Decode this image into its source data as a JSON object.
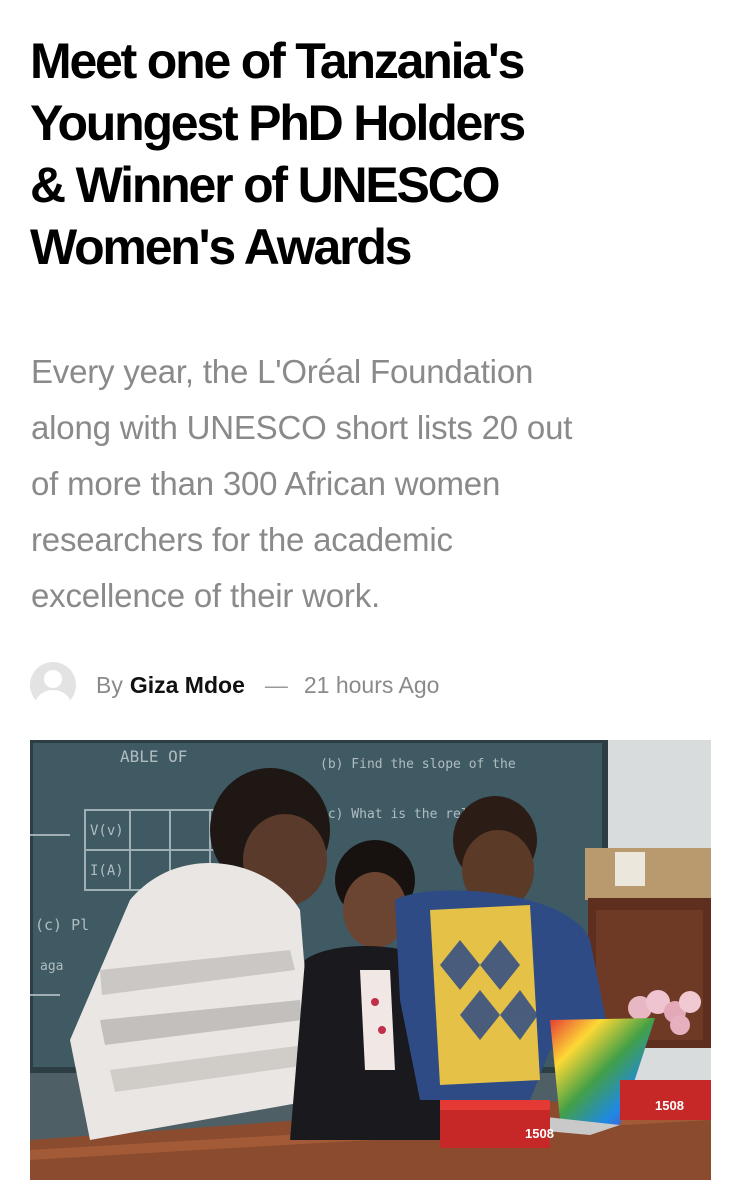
{
  "article": {
    "headline_lines": [
      "Meet one of Tanzania's",
      "Youngest PhD Holders",
      "& Winner of UNESCO",
      "Women's Awards"
    ],
    "dek_lines": [
      "Every year, the L'Oréal Foundation",
      "along with UNESCO short lists 20 out",
      "of more than 300 African women",
      "researchers for the academic",
      "excellence of their work."
    ],
    "byline": {
      "by_label": "By",
      "author": "Giza Mdoe",
      "separator": "—",
      "time": "21 hours Ago"
    },
    "photo": {
      "blackboard_text": [
        "ABLE OF",
        "(b) Find the slope of the",
        "(c) What is the relation",
        "V(v)",
        "I(A)",
        "(c) Pl",
        "aga"
      ],
      "box_labels": [
        "1508",
        "1508"
      ]
    }
  },
  "colors": {
    "headline": "#000000",
    "dek": "#8a8a8a",
    "author": "#111111",
    "meta": "#8a8a8a"
  }
}
